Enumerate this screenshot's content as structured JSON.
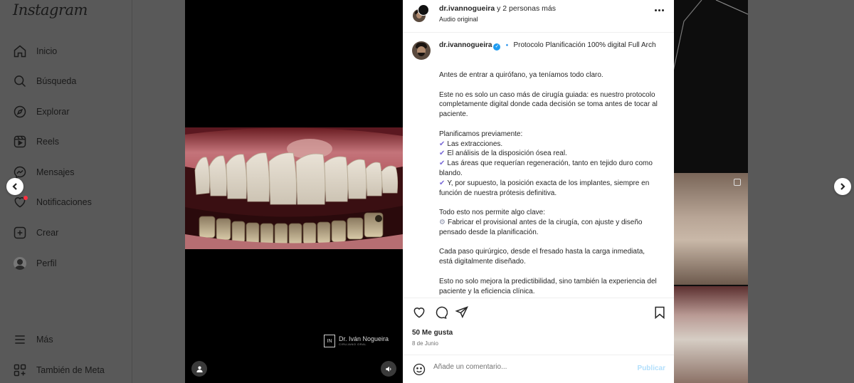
{
  "app": {
    "logo_text": "Instagram"
  },
  "sidebar": {
    "items": [
      {
        "label": "Inicio",
        "icon": "home-icon"
      },
      {
        "label": "Búsqueda",
        "icon": "search-icon"
      },
      {
        "label": "Explorar",
        "icon": "compass-icon"
      },
      {
        "label": "Reels",
        "icon": "reels-icon"
      },
      {
        "label": "Mensajes",
        "icon": "messenger-icon"
      },
      {
        "label": "Notificaciones",
        "icon": "heart-icon"
      },
      {
        "label": "Crear",
        "icon": "plus-square-icon"
      },
      {
        "label": "Perfil",
        "icon": "avatar"
      }
    ],
    "more_label": "Más",
    "meta_label": "También de Meta"
  },
  "media": {
    "watermark_mark": "IN",
    "watermark_name": "Dr. Iván Nogueira",
    "watermark_sub": "CIRUJANO ORAL"
  },
  "post": {
    "header": {
      "username": "dr.ivannogueira",
      "others": "y 2 personas más",
      "audio": "Audio original"
    },
    "caption": {
      "username": "dr.ivannogueira",
      "verified_mark": "✓",
      "diamond": "🔹",
      "title": "Protocolo Planificación 100% digital Full Arch",
      "paragraphs": [
        [
          "Antes de entrar a quirófano, ya teníamos todo claro."
        ],
        [
          "Este no es solo un caso más de cirugía guiada: es nuestro protocolo completamente digital donde cada decisión se toma antes de tocar al paciente."
        ],
        [
          "Planificamos previamente:"
        ],
        [
          "Todo esto nos permite algo clave:"
        ],
        [
          "Cada paso quirúrgico, desde el fresado hasta la carga inmediata, está digitalmente diseñado."
        ],
        [
          "Esto no solo mejora la predictibilidad, sino también la experiencia del paciente y la eficiencia clínica."
        ]
      ],
      "check": "✔",
      "gear": "⚙",
      "checklist": [
        "Las extracciones.",
        "El análisis de la disposición ósea real.",
        "Las áreas que requerían regeneración, tanto en tejido duro como blando.",
        "Y, por supuesto, la posición exacta de los implantes, siempre en función de nuestra prótesis definitiva."
      ],
      "gear_item": "Fabricar el provisional antes de la cirugía, con ajuste y diseño pensado desde la planificación."
    },
    "likes": "50 Me gusta",
    "date": "8 de Junio",
    "comment_placeholder": "Añade un comentario...",
    "publish_label": "Publicar"
  }
}
